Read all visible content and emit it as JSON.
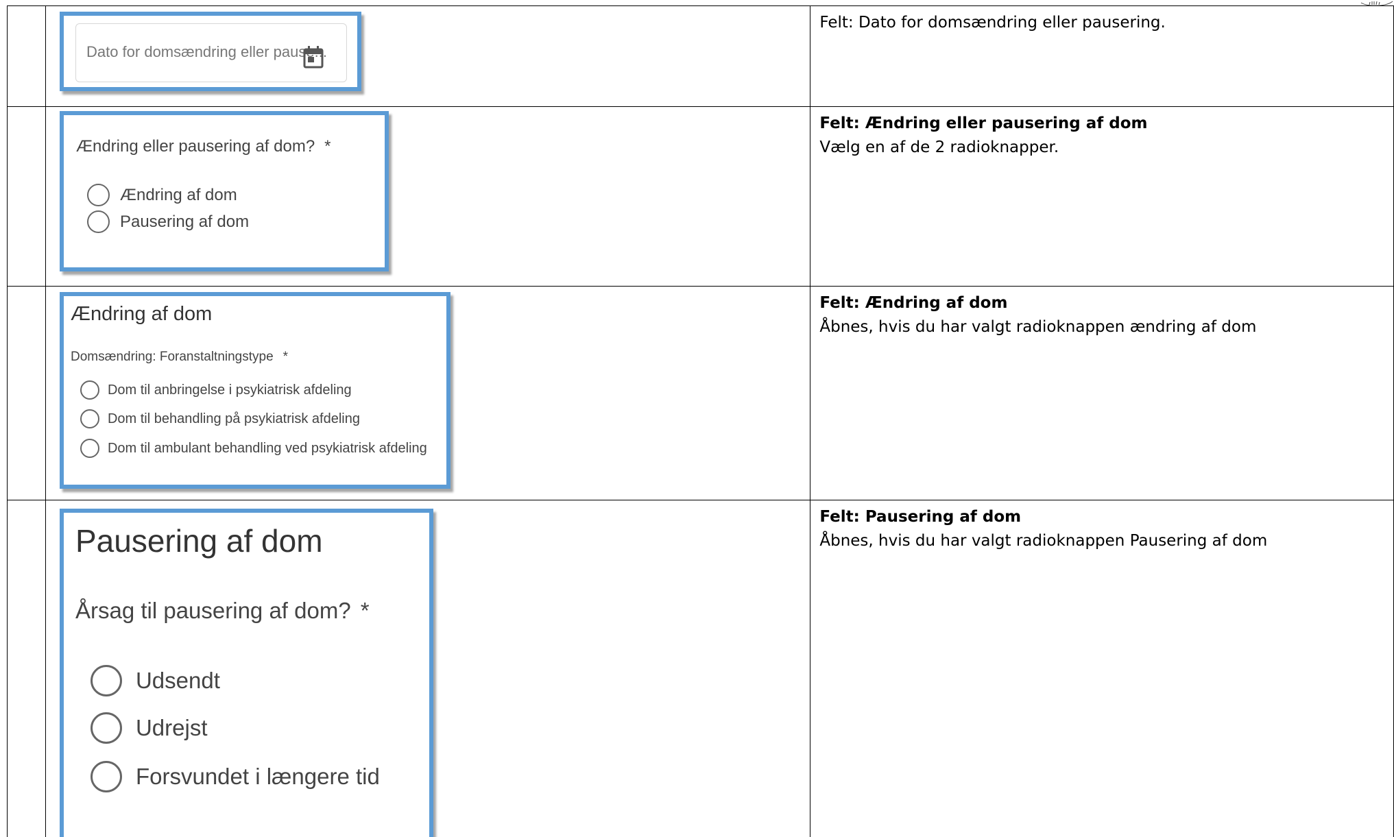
{
  "rows": [
    {
      "field": {
        "date_placeholder": "Dato for domsændring eller pause..."
      },
      "description": {
        "plain": "Felt: Dato for domsændring eller pausering."
      }
    },
    {
      "field": {
        "question": "Ændring eller pausering af dom?",
        "required_mark": "*",
        "options": [
          "Ændring af dom",
          "Pausering af dom"
        ]
      },
      "description": {
        "bold": "Felt: Ændring eller pausering af dom",
        "plain": "Vælg en af de 2 radioknapper."
      }
    },
    {
      "field": {
        "section_title": "Ændring af dom",
        "question": "Domsændring: Foranstaltningstype",
        "required_mark": "*",
        "options": [
          "Dom til anbringelse i psykiatrisk afdeling",
          "Dom til behandling på psykiatrisk afdeling",
          "Dom til ambulant behandling ved psykiatrisk afdeling"
        ]
      },
      "description": {
        "bold": "Felt: Ændring af dom",
        "plain": "Åbnes, hvis du har valgt radioknappen ændring af dom"
      }
    },
    {
      "field": {
        "section_title": "Pausering af dom",
        "question": "Årsag til pausering af dom?",
        "required_mark": "*",
        "options": [
          "Udsendt",
          "Udrejst",
          "Forsvundet i længere tid"
        ]
      },
      "description": {
        "bold": "Felt: Pausering af dom",
        "plain": "Åbnes, hvis du har valgt radioknappen Pausering af dom"
      }
    }
  ],
  "colors": {
    "panel_border": "#5b9bd5",
    "table_border": "#000000",
    "form_text": "#444444"
  },
  "icons": [
    "calendar-icon"
  ]
}
